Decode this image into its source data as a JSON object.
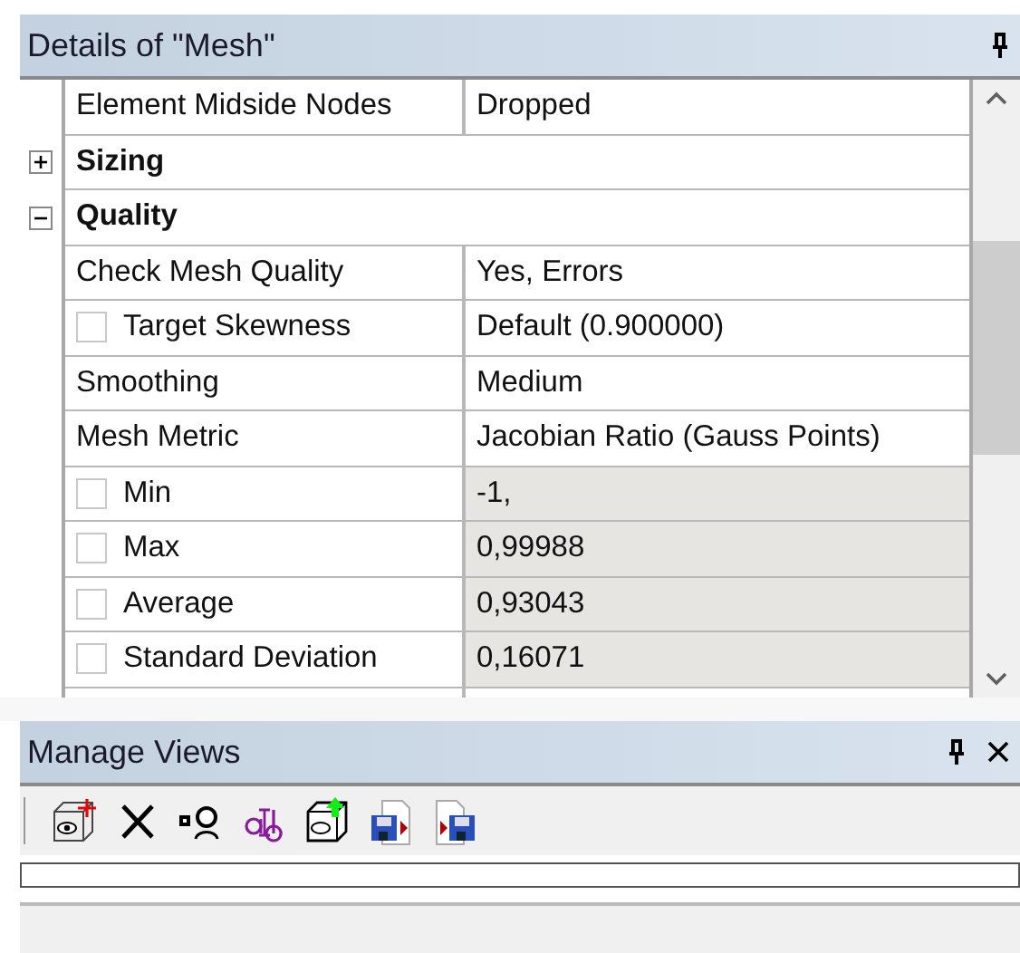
{
  "details_panel": {
    "title": "Details of \"Mesh\"",
    "rows": [
      {
        "kind": "property",
        "label": "Element Midside Nodes",
        "value": "Dropped",
        "readonly": false
      },
      {
        "kind": "group",
        "label": "Sizing",
        "expanded": false
      },
      {
        "kind": "group",
        "label": "Quality",
        "expanded": true
      },
      {
        "kind": "property",
        "label": "Check Mesh Quality",
        "value": "Yes, Errors",
        "readonly": false
      },
      {
        "kind": "checkbox",
        "label": "Target Skewness",
        "value": "Default (0.900000)",
        "checked": false,
        "readonly": false
      },
      {
        "kind": "property",
        "label": "Smoothing",
        "value": "Medium",
        "readonly": false
      },
      {
        "kind": "property",
        "label": "Mesh Metric",
        "value": "Jacobian Ratio (Gauss Points)",
        "readonly": false
      },
      {
        "kind": "checkbox",
        "label": "Min",
        "value": "-1,",
        "checked": false,
        "readonly": true
      },
      {
        "kind": "checkbox",
        "label": "Max",
        "value": "0,99988",
        "checked": false,
        "readonly": true
      },
      {
        "kind": "checkbox",
        "label": "Average",
        "value": "0,93043",
        "checked": false,
        "readonly": true
      },
      {
        "kind": "checkbox",
        "label": "Standard Deviation",
        "value": "0,16071",
        "checked": false,
        "readonly": true
      }
    ]
  },
  "manage_views_panel": {
    "title": "Manage Views"
  }
}
